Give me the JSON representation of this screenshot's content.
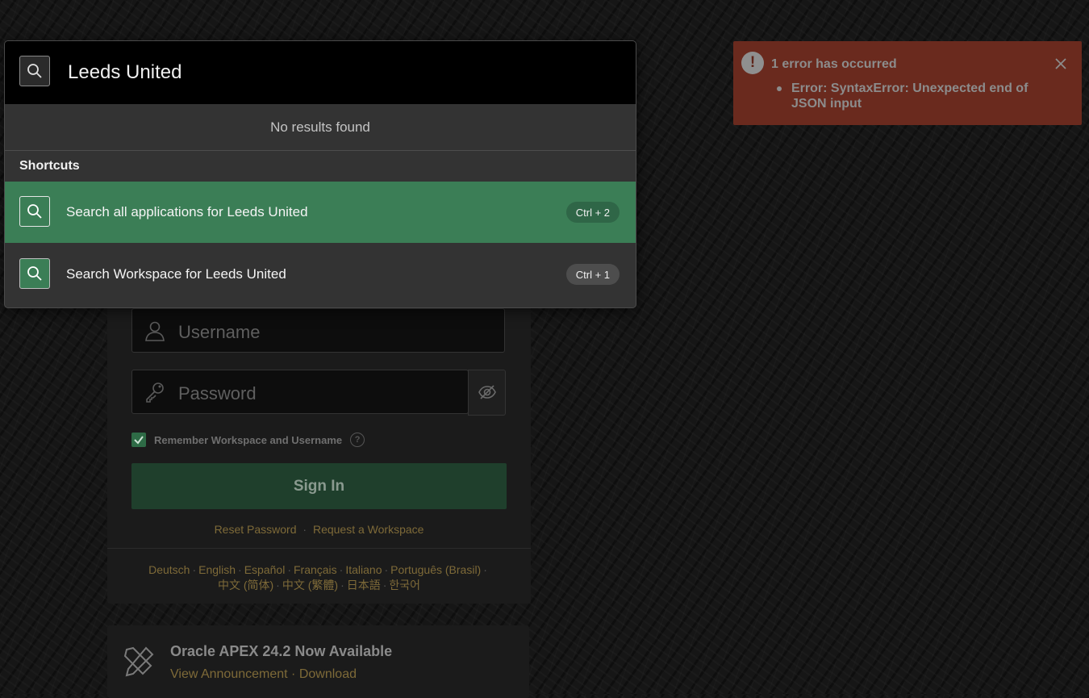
{
  "search": {
    "query": "Leeds United",
    "no_results": "No results found",
    "shortcuts_heading": "Shortcuts",
    "shortcuts": [
      {
        "label": "Search all applications for Leeds United",
        "key": "Ctrl + 2",
        "active": true
      },
      {
        "label": "Search Workspace for Leeds United",
        "key": "Ctrl + 1",
        "active": false
      }
    ]
  },
  "error": {
    "title": "1 error has occurred",
    "messages": [
      "Error: SyntaxError: Unexpected end of JSON input"
    ],
    "color": "#6a2a1e"
  },
  "login": {
    "username_placeholder": "Username",
    "password_placeholder": "Password",
    "remember_label": "Remember Workspace and Username",
    "remember_checked": true,
    "help_glyph": "?",
    "signin_label": "Sign In",
    "reset_password": "Reset Password",
    "request_workspace": "Request a Workspace",
    "languages_line1": [
      "Deutsch",
      "English",
      "Español",
      "Français",
      "Italiano",
      "Português (Brasil)"
    ],
    "languages_line2": [
      "中文 (简体)",
      "中文 (繁體)",
      "日本語",
      "한국어"
    ],
    "accent": "#7e6a38",
    "button_color": "#1f3f2c"
  },
  "promo": {
    "title": "Oracle APEX 24.2 Now Available",
    "view_announcement": "View Announcement",
    "separator": "·",
    "download": "Download"
  },
  "icons": {
    "search": "search-icon",
    "user": "user-icon",
    "key": "key-icon",
    "eye_off": "eye-off-icon",
    "check": "check-icon",
    "close": "close-icon",
    "error": "error-icon",
    "tools": "tools-icon"
  }
}
